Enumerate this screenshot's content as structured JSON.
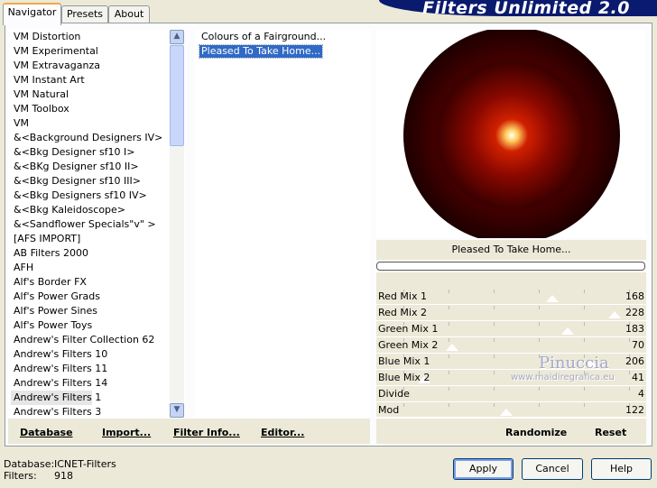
{
  "tabs": [
    {
      "label": "Navigator",
      "active": true
    },
    {
      "label": "Presets",
      "active": false
    },
    {
      "label": "About",
      "active": false
    }
  ],
  "app_title": "Filters Unlimited 2.0",
  "categories": [
    "VM Distortion",
    "VM Experimental",
    "VM Extravaganza",
    "VM Instant Art",
    "VM Natural",
    "VM Toolbox",
    "VM",
    "&<Background Designers IV>",
    "&<Bkg Designer sf10 I>",
    "&<BKg Designer sf10 II>",
    "&<Bkg Designer sf10 III>",
    "&<Bkg Designers sf10 IV>",
    "&<Bkg Kaleidoscope>",
    "&<Sandflower Specials\"v\" >",
    "[AFS IMPORT]",
    "AB Filters 2000",
    "AFH",
    "Alf's Border FX",
    "Alf's Power Grads",
    "Alf's Power Sines",
    "Alf's Power Toys",
    "Andrew's Filter Collection 62",
    "Andrew's Filters 10",
    "Andrew's Filters 11",
    "Andrew's Filters 14",
    "Andrew's Filters 1",
    "Andrew's Filters 3"
  ],
  "selected_category": "Andrew's Filters 1",
  "filters": [
    "Colours of a Fairground...",
    "Pleased To Take Home..."
  ],
  "selected_filter": "Pleased To Take Home...",
  "preview_filter_name": "Pleased To Take Home...",
  "params": [
    {
      "label": "Red Mix 1",
      "value": "168",
      "level": 0.66
    },
    {
      "label": "Red Mix 2",
      "value": "228",
      "level": 0.9
    },
    {
      "label": "Green Mix 1",
      "value": "183",
      "level": 0.72
    },
    {
      "label": "Green Mix 2",
      "value": "70",
      "level": 0.27
    },
    {
      "label": "Blue Mix 1",
      "value": "206",
      "level": 0.81
    },
    {
      "label": "Blue Mix 2",
      "value": "41",
      "level": 0.16
    },
    {
      "label": "Divide",
      "value": "4",
      "level": null
    },
    {
      "label": "Mod",
      "value": "122",
      "level": 0.48
    }
  ],
  "bottom_links": {
    "database": "Database",
    "import": "Import...",
    "filter_info": "Filter Info...",
    "editor": "Editor..."
  },
  "randomize": "Randomize",
  "reset": "Reset",
  "buttons": {
    "apply": "Apply",
    "cancel": "Cancel",
    "help": "Help"
  },
  "status": {
    "database_label": "Database:",
    "database_value": "ICNET-Filters",
    "filters_label": "Filters:",
    "filters_value": "918"
  },
  "watermark": {
    "name": "Pinuccia",
    "site": "www.maidiregrafica.eu"
  },
  "colors": {
    "title_bar": "#0a1a6e",
    "selection": "#316ac5",
    "preview_outer": "#2a0000",
    "preview_ring": "#8b0a00",
    "preview_center": "#ffffff"
  }
}
